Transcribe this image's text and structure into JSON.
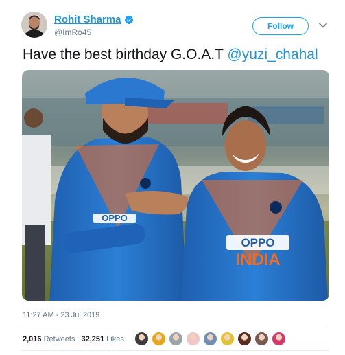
{
  "author": {
    "display_name": "Rohit Sharma",
    "handle": "@ImRo45",
    "verified": true,
    "avatar_icon": "profile-photo-icon"
  },
  "follow_label": "Follow",
  "tweet": {
    "text_before": "Have the best birthday G.O.A.T ",
    "mention": "@yuzi_chahal",
    "timestamp": "11:27 AM - 23 Jul 2019"
  },
  "photo": {
    "description_icon": "cricket-players-photo",
    "jersey_sponsor": "OPPO",
    "jersey_text": "INDIA"
  },
  "stats": {
    "retweets_count": "2,016",
    "retweets_label": "Retweets",
    "likes_count": "32,251",
    "likes_label": "Likes"
  },
  "likers": [
    {
      "color": "#3d3d3d"
    },
    {
      "color": "#e3a81b"
    },
    {
      "color": "#9aa4ad"
    },
    {
      "color": "#f1c6c9"
    },
    {
      "color": "#6f8fb3"
    },
    {
      "color": "#e2c23a"
    },
    {
      "color": "#5b2d22"
    },
    {
      "color": "#7a5a52"
    },
    {
      "color": "#d23a6b"
    }
  ],
  "colors": {
    "link": "#1b95e0",
    "follow_border": "#1da1f2",
    "muted": "#657786",
    "jersey_blue": "#1f6fc6",
    "jersey_orange": "#f26b1f"
  }
}
